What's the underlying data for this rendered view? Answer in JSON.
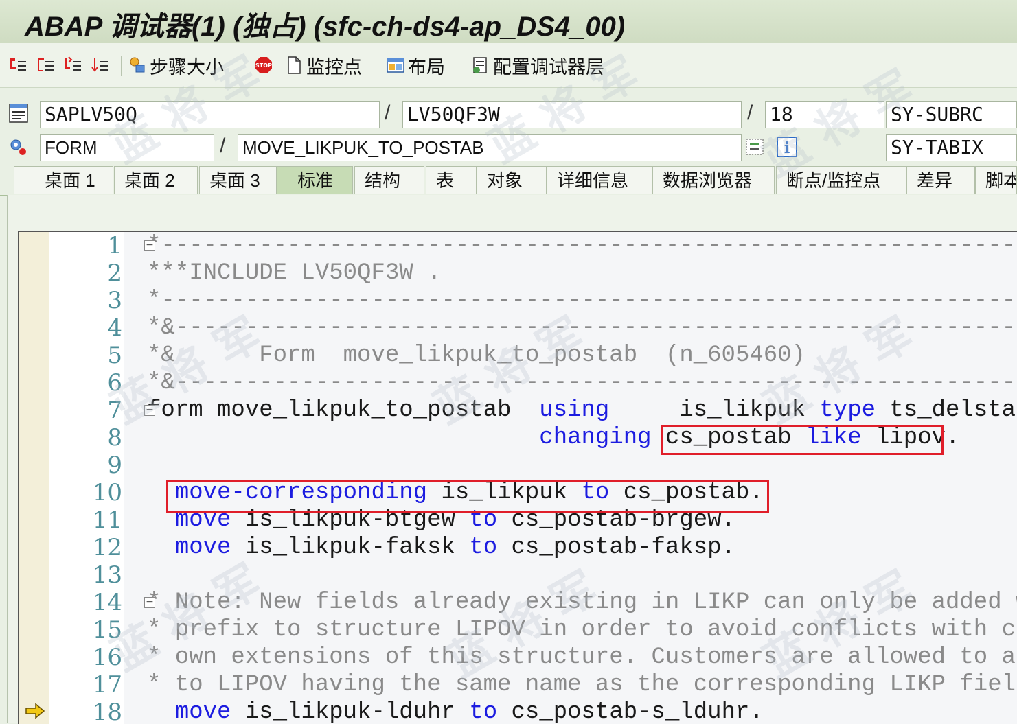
{
  "window": {
    "title": "ABAP 调试器(1)  (独占) (sfc-ch-ds4-ap_DS4_00)"
  },
  "toolbar": {
    "step_size_label": "步骤大小",
    "watchpoint_label": "监控点",
    "layout_label": "布局",
    "config_layers_label": "配置调试器层"
  },
  "position": {
    "program": "SAPLV50Q",
    "include": "LV50QF3W",
    "line": "18",
    "type": "FORM",
    "name": "MOVE_LIKPUK_TO_POSTAB",
    "sysfield1": "SY-SUBRC",
    "sysfield2": "SY-TABIX",
    "sep": "/"
  },
  "tabs": [
    "桌面 1",
    "桌面 2",
    "桌面 3",
    "标准",
    "结构",
    "表",
    "对象",
    "详细信息",
    "数据浏览器",
    "断点/监控点",
    "差异",
    "脚本"
  ],
  "code": {
    "lines": [
      {
        "n": "1",
        "parts": [
          [
            "cm",
            "*-------------------------------------------------------------------"
          ]
        ]
      },
      {
        "n": "2",
        "parts": [
          [
            "cm",
            "***INCLUDE LV50QF3W ."
          ]
        ]
      },
      {
        "n": "3",
        "parts": [
          [
            "cm",
            "*-------------------------------------------------------------------"
          ]
        ]
      },
      {
        "n": "4",
        "parts": [
          [
            "cm",
            "*&------------------------------------------------------------------"
          ]
        ]
      },
      {
        "n": "5",
        "parts": [
          [
            "cm",
            "*&      Form  move_likpuk_to_postab  (n_605460)"
          ]
        ]
      },
      {
        "n": "6",
        "parts": [
          [
            "cm",
            "*&------------------------------------------------------------------"
          ]
        ]
      },
      {
        "n": "7",
        "parts": [
          [
            "tx",
            "form move_likpuk_to_postab  "
          ],
          [
            "kw",
            "using"
          ],
          [
            "tx",
            "     is_likpuk "
          ],
          [
            "kw",
            "type"
          ],
          [
            "tx",
            " ts_delstat"
          ]
        ]
      },
      {
        "n": "8",
        "parts": [
          [
            "tx",
            "                            "
          ],
          [
            "kw",
            "changing"
          ],
          [
            "tx",
            " cs_postab "
          ],
          [
            "kw",
            "like"
          ],
          [
            "tx",
            " lipov."
          ]
        ]
      },
      {
        "n": "9",
        "parts": []
      },
      {
        "n": "10",
        "parts": [
          [
            "tx",
            "  "
          ],
          [
            "kw",
            "move-corresponding"
          ],
          [
            "tx",
            " is_likpuk "
          ],
          [
            "kw",
            "to"
          ],
          [
            "tx",
            " cs_postab."
          ]
        ]
      },
      {
        "n": "11",
        "parts": [
          [
            "tx",
            "  "
          ],
          [
            "kw",
            "move"
          ],
          [
            "tx",
            " is_likpuk-btgew "
          ],
          [
            "kw",
            "to"
          ],
          [
            "tx",
            " cs_postab-brgew."
          ]
        ]
      },
      {
        "n": "12",
        "parts": [
          [
            "tx",
            "  "
          ],
          [
            "kw",
            "move"
          ],
          [
            "tx",
            " is_likpuk-faksk "
          ],
          [
            "kw",
            "to"
          ],
          [
            "tx",
            " cs_postab-faksp."
          ]
        ]
      },
      {
        "n": "13",
        "parts": []
      },
      {
        "n": "14",
        "parts": [
          [
            "cm",
            "* Note: New fields already existing in LIKP can only be added wi"
          ]
        ]
      },
      {
        "n": "15",
        "parts": [
          [
            "cm",
            "* prefix to structure LIPOV in order to avoid conflicts with cus"
          ]
        ]
      },
      {
        "n": "16",
        "parts": [
          [
            "cm",
            "* own extensions of this structure. Customers are allowed to add"
          ]
        ]
      },
      {
        "n": "17",
        "parts": [
          [
            "cm",
            "* to LIPOV having the same name as the corresponding LIKP fields"
          ]
        ]
      },
      {
        "n": "18",
        "parts": [
          [
            "tx",
            "  "
          ],
          [
            "kw",
            "move"
          ],
          [
            "tx",
            " is_likpuk-lduhr "
          ],
          [
            "kw",
            "to"
          ],
          [
            "tx",
            " cs_postab-s_lduhr."
          ]
        ]
      }
    ]
  },
  "colors": {
    "keyword": "#1c1ce0",
    "comment": "#8a8a8a",
    "highlight_box": "#e01e2a",
    "line_number": "#4f8f9a"
  }
}
